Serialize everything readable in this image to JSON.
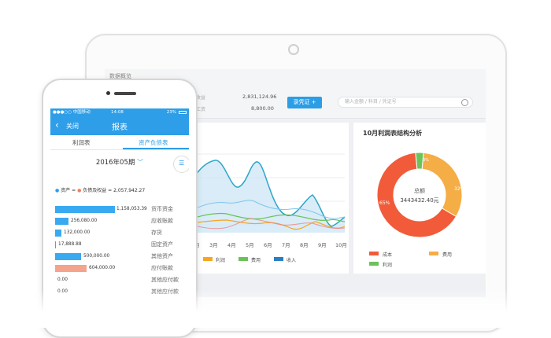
{
  "tablet": {
    "breadcrumb": "数据概览",
    "rows": [
      {
        "label": "本期收益",
        "value": "2,831,124.96"
      },
      {
        "label": "计提工资",
        "value": "8,800.00"
      }
    ],
    "voucher_button": "录凭证 +",
    "search_placeholder": "输入金额 / 科目 / 凭证号",
    "line_chart": {
      "x_labels": [
        "2月",
        "3月",
        "4月",
        "5月",
        "6月",
        "7月",
        "8月",
        "9月",
        "10月"
      ],
      "legend": [
        {
          "label": "利润",
          "color": "#f5a623"
        },
        {
          "label": "费用",
          "color": "#6ac259"
        },
        {
          "label": "收入",
          "color": "#2b7fc0"
        }
      ]
    },
    "donut": {
      "title": "10月利润表结构分析",
      "center_label": "总额",
      "center_value": "3443432.40元",
      "slices": [
        {
          "label": "65%",
          "value": 65,
          "color": "#f15b3a"
        },
        {
          "label": "32%",
          "value": 32,
          "color": "#f5ad45"
        },
        {
          "label": "3%",
          "value": 3,
          "color": "#6cc35a"
        }
      ],
      "legend": [
        {
          "label": "成本",
          "color": "#f15b3a"
        },
        {
          "label": "费用",
          "color": "#f5ad45"
        },
        {
          "label": "利润",
          "color": "#6cc35a"
        }
      ]
    }
  },
  "phone": {
    "status": {
      "carrier": "●●●○○ 中国移动 ",
      "time": "14:08",
      "battery": "23%"
    },
    "nav": {
      "back": "关闭",
      "title": "报表"
    },
    "tabs": [
      "利润表",
      "资产负债表"
    ],
    "period": "2016年05期",
    "equation": {
      "asset": "资产",
      "eq": "=",
      "liab": "负债及权益",
      "value": "= 2,057,942.27"
    },
    "bars": [
      {
        "value": "1,158,053.39",
        "name": "货币资金",
        "fill": 1.0,
        "color": "#3aaaf0"
      },
      {
        "value": "256,080.00",
        "name": "应收账款",
        "fill": 0.22,
        "color": "#3aaaf0"
      },
      {
        "value": "132,000.00",
        "name": "存货",
        "fill": 0.11,
        "color": "#3aaaf0"
      },
      {
        "value": "17,888.88",
        "name": "固定资产",
        "fill": 0.015,
        "color": "#3aaaf0"
      },
      {
        "value": "500,000.00",
        "name": "其他资产",
        "fill": 0.43,
        "color": "#3aaaf0"
      },
      {
        "value": "604,000.00",
        "name": "应付账款",
        "fill": 0.52,
        "color": "#f4a38c"
      },
      {
        "value": "0.00",
        "name": "其他应付款",
        "fill": 0,
        "color": "#f4a38c"
      },
      {
        "value": "0.00",
        "name": "其他应付款",
        "fill": 0,
        "color": "#f4a38c"
      }
    ]
  }
}
